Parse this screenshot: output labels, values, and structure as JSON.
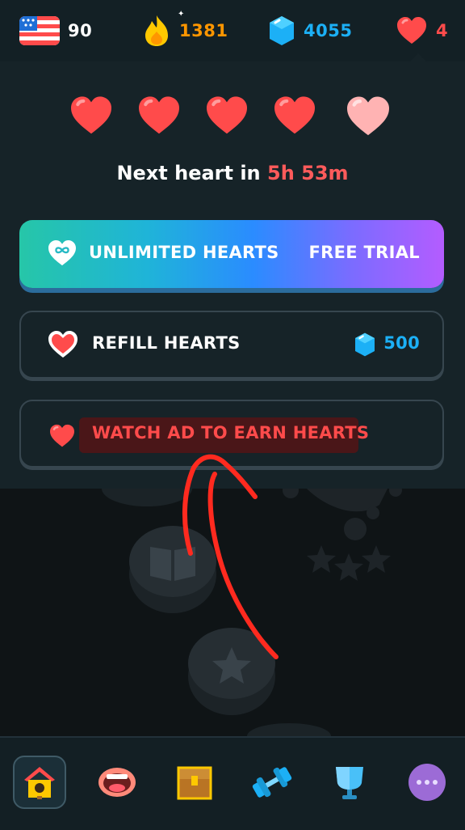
{
  "stats": {
    "flag_icon": "us-flag-icon",
    "streak_lang_value": "90",
    "fire_value": "1381",
    "gems_value": "4055",
    "hearts_value": "4"
  },
  "hearts_panel": {
    "filled_count": 4,
    "total_count": 5,
    "next_label": "Next heart in",
    "next_time": "5h 53m"
  },
  "buttons": {
    "unlimited_label": "UNLIMITED HEARTS",
    "unlimited_trial": "FREE TRIAL",
    "refill_label": "REFILL HEARTS",
    "refill_cost": "500",
    "watch_ad_label": "WATCH AD TO EARN HEARTS"
  },
  "colors": {
    "heart_red": "#ff4b4b",
    "heart_faded": "#ffb3b3",
    "fire_orange": "#ff9600",
    "gem_blue": "#1cb0f6",
    "annotation_red": "#ff2a1f"
  },
  "nav": [
    {
      "icon": "home-birdhouse-icon",
      "active": true
    },
    {
      "icon": "mouth-speaking-icon",
      "active": false
    },
    {
      "icon": "treasure-chest-icon",
      "active": false
    },
    {
      "icon": "dumbbell-icon",
      "active": false
    },
    {
      "icon": "shield-league-icon",
      "active": false
    },
    {
      "icon": "more-dots-icon",
      "active": false
    }
  ]
}
